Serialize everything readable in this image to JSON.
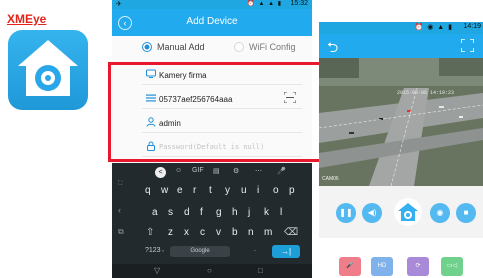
{
  "brand": {
    "title": "XMEye"
  },
  "phone": {
    "status_time": "15:32",
    "title": "Add Device",
    "modes": {
      "manual": "Manual Add",
      "wifi": "WiFi Config"
    },
    "fields": {
      "device_name": "Kamery firma",
      "serial": "05737aef256764aaa",
      "username": "admin",
      "password_placeholder": "Password(Default is null)"
    },
    "keyboard": {
      "tools": [
        "<",
        "☺",
        "GIF",
        "▤",
        "⚙",
        "⋯",
        "🎤"
      ],
      "row1": [
        "q",
        "w",
        "e",
        "r",
        "t",
        "y",
        "u",
        "i",
        "o",
        "p"
      ],
      "row2": [
        "a",
        "s",
        "d",
        "f",
        "g",
        "h",
        "j",
        "k",
        "l"
      ],
      "row3": [
        "z",
        "x",
        "c",
        "v",
        "b",
        "n",
        "m"
      ],
      "numbers": "?123",
      "space_label": "Google",
      "enter": "→|"
    }
  },
  "rphone": {
    "status_time": "14:19",
    "video_timestamp": "2015-05-06 14:19:23",
    "camera_label": "CAM06"
  },
  "colors": {
    "accent": "#22aaee",
    "highlight": "#e8192c"
  }
}
